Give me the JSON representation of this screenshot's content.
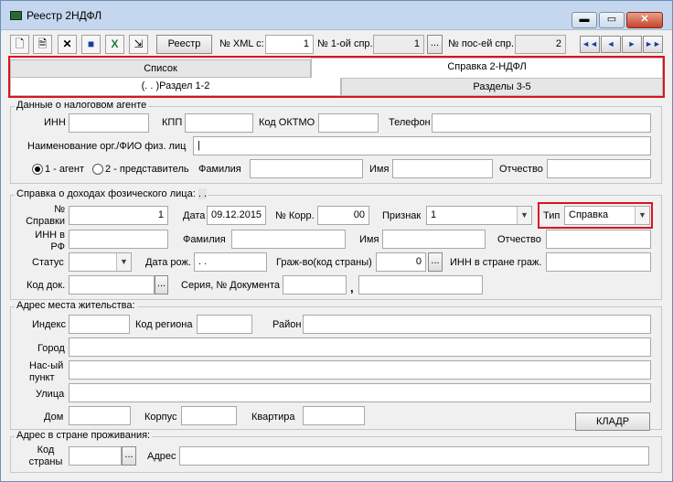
{
  "window": {
    "title": "Реестр 2НДФЛ",
    "min": "▬",
    "max": "▭",
    "close": "✕"
  },
  "toolbar": {
    "icons": [
      "new-icon",
      "document-icon",
      "delete-icon",
      "save-icon",
      "excel-icon",
      "export-icon"
    ],
    "reestr_label": "Реестр",
    "xml_label": "№ XML с:",
    "xml_value": "1",
    "first_label": "№ 1-ой спр.",
    "first_value": "1",
    "dots": "...",
    "last_label": "№ пос-ей спр.",
    "last_value": "2",
    "nav": [
      "◄◄",
      "◄",
      "►",
      "►►"
    ]
  },
  "tabs": {
    "row1": [
      "Список",
      "Справка 2-НДФЛ"
    ],
    "row2": [
      "(. . )Раздел 1-2",
      "Разделы 3-5"
    ]
  },
  "agent": {
    "title": "Данные о налоговом агенте",
    "inn": "ИНН",
    "kpp": "КПП",
    "oktmo": "Код ОКТМО",
    "phone": "Телефон",
    "org_name": "Наименование орг./ФИО физ. лиц",
    "org_name_value": "|",
    "radio1": "1 - агент",
    "radio2": "2 - представитель",
    "surname": "Фамилия",
    "name": "Имя",
    "patronymic": "Отчество"
  },
  "income": {
    "title": "Справка о доходах фозического лица:",
    "title_suffix": ". .",
    "spravka_no_label": "№ Справки",
    "spravka_no": "1",
    "date_label": "Дата",
    "date_value": "09.12.2015",
    "corr_label": "№ Корр.",
    "corr_value": "00",
    "sign_label": "Признак",
    "sign_value": "1",
    "type_label": "Тип",
    "type_value": "Справка",
    "inn_rf": "ИНН в РФ",
    "surname": "Фамилия",
    "name": "Имя",
    "patronymic": "Отчество",
    "status": "Статус",
    "birthdate_label": "Дата рож.",
    "birthdate_value": ". .",
    "citizenship_label": "Граж-во(код страны)",
    "citizenship_value": "0",
    "citizenship_dots": "...",
    "inn_foreign": "ИНН в стране граж.",
    "doc_code": "Код док.",
    "doc_dots": "...",
    "doc_series": "Серия, № Документа",
    "comma": ","
  },
  "address": {
    "title": "Адрес места жительства:",
    "index": "Индекс",
    "region": "Код региона",
    "district": "Район",
    "city": "Город",
    "settlement": "Нас-ый пункт",
    "street": "Улица",
    "house": "Дом",
    "building": "Корпус",
    "flat": "Квартира",
    "kladr": "КЛАДР"
  },
  "foreign": {
    "title": "Адрес в стране проживания:",
    "country_code": "Код страны",
    "dots": "...",
    "address": "Адрес"
  }
}
